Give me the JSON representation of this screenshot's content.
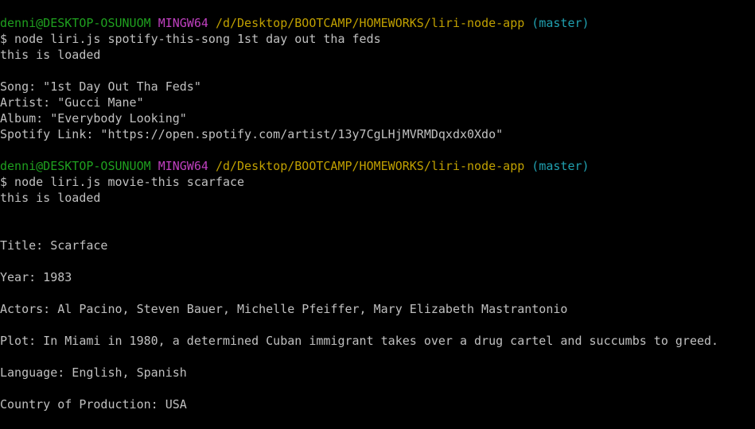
{
  "colors": {
    "background": "#000000",
    "text": "#c0c0c0",
    "user_host": "#1fa01f",
    "system": "#bf40bf",
    "path": "#c0a000",
    "branch": "#20a0b0"
  },
  "prompts": [
    {
      "user_host": "denni@DESKTOP-OSUNUOM",
      "system": "MINGW64",
      "path": "/d/Desktop/BOOTCAMP/HOMEWORKS/liri-node-app",
      "branch": "(master)",
      "command": "$ node liri.js spotify-this-song 1st day out tha feds"
    },
    {
      "user_host": "denni@DESKTOP-OSUNUOM",
      "system": "MINGW64",
      "path": "/d/Desktop/BOOTCAMP/HOMEWORKS/liri-node-app",
      "branch": "(master)",
      "command": "$ node liri.js movie-this scarface"
    }
  ],
  "song_output": {
    "loaded": "this is loaded",
    "song": "Song: \"1st Day Out Tha Feds\"",
    "artist": "Artist: \"Gucci Mane\"",
    "album": "Album: \"Everybody Looking\"",
    "link": "Spotify Link: \"https://open.spotify.com/artist/13y7CgLHjMVRMDqxdx0Xdo\""
  },
  "movie_output": {
    "loaded": "this is loaded",
    "title": "Title: Scarface",
    "year": "Year: 1983",
    "actors": "Actors: Al Pacino, Steven Bauer, Michelle Pfeiffer, Mary Elizabeth Mastrantonio",
    "plot": "Plot: In Miami in 1980, a determined Cuban immigrant takes over a drug cartel and succumbs to greed.",
    "language": "Language: English, Spanish",
    "country": "Country of Production: USA"
  }
}
